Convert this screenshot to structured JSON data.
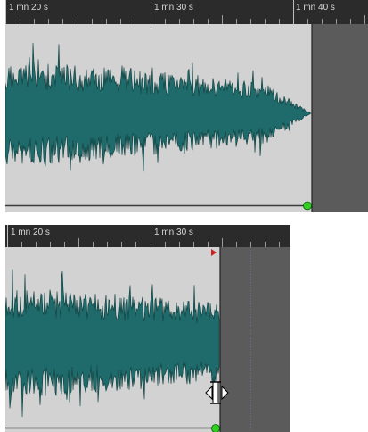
{
  "top_panel": {
    "ruler_labels": [
      "1 mn 20 s",
      "1 mn 30 s",
      "1 mn 40 s"
    ]
  },
  "bottom_panel": {
    "ruler_labels": [
      "1 mn 20 s",
      "1 mn 30 s"
    ]
  },
  "colors": {
    "ruler_bg": "#2b2b2b",
    "ruler_text": "#d8d8d8",
    "clip_bg": "#d2d2d2",
    "waveform_fill": "#1f6a6a",
    "waveform_edge": "#0e3d3d",
    "gray_region": "#5b5b5b",
    "handle_green": "#30d020",
    "marker_red": "#d02020"
  },
  "icons": {
    "resize_cursor": "resize-horizontal-cursor-icon",
    "end_marker": "red-triangle-marker-icon",
    "clip_handle": "green-dot-handle-icon"
  }
}
